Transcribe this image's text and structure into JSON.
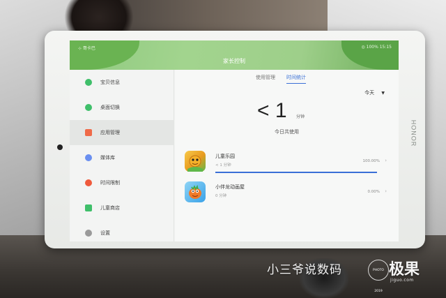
{
  "status_bar": {
    "left": "⊹ 哥卡巴",
    "right": "◎ 100% 15:15"
  },
  "header": {
    "title": "家长控制"
  },
  "sidebar": {
    "items": [
      {
        "label": "宝贝信息",
        "icon": "baby-info-icon",
        "color": "#3fbf6a"
      },
      {
        "label": "桌面切换",
        "icon": "desktop-switch-icon",
        "color": "#3fbf6a"
      },
      {
        "label": "应用管理",
        "icon": "app-management-icon",
        "color": "#ef6a48"
      },
      {
        "label": "媒体库",
        "icon": "media-library-icon",
        "color": "#6a8ff0"
      },
      {
        "label": "时间限制",
        "icon": "time-limit-icon",
        "color": "#ef5a3c"
      },
      {
        "label": "儿童商店",
        "icon": "kids-store-icon",
        "color": "#3fbf6a"
      },
      {
        "label": "设置",
        "icon": "settings-icon",
        "color": "#9a9a9a"
      }
    ]
  },
  "tabs": [
    {
      "label": "使用管理"
    },
    {
      "label": "时间统计"
    }
  ],
  "period": {
    "label": "今天",
    "icon": "dropdown-arrow-icon"
  },
  "summary": {
    "value": "< 1",
    "unit": "分钟",
    "caption": "今日共使用"
  },
  "apps": [
    {
      "name": "儿童乐园",
      "time": "< 1 分钟",
      "percent": "100.00%",
      "fill": 1.0,
      "icon": "kids-park-app-icon",
      "color": "#f2b632"
    },
    {
      "name": "小伴龙动画屋",
      "time": "0 分钟",
      "percent": "0.00%",
      "fill": 0.0,
      "icon": "dragon-cartoon-app-icon",
      "color": "#3aa2e8"
    }
  ],
  "device": {
    "brand": "HONOR"
  },
  "watermark": {
    "author": "小三爷说数码",
    "logo": "极果",
    "site": "jiguo.com",
    "badge": "PHOTO 2019"
  },
  "colors": {
    "accent": "#3a6fd6",
    "header_green": "#8fc97f"
  }
}
